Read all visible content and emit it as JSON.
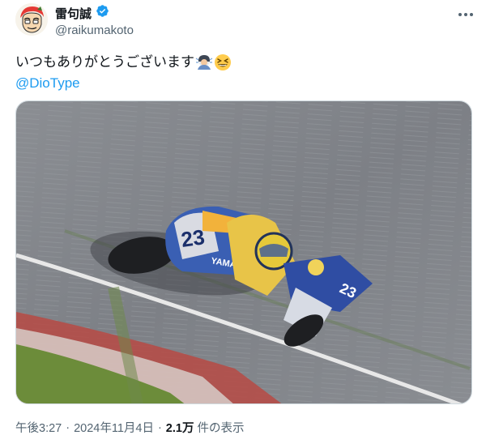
{
  "author": {
    "display_name": "雷句誠",
    "handle": "@raikumakoto",
    "verified_icon": "verified-badge-icon",
    "avatar_icon": "cartoon-avatar"
  },
  "more_icon": "more-dots-icon",
  "tweet": {
    "line1": "いつもありがとうございます",
    "emojis": [
      "racing-rider-emoji",
      "grinning-squinting-face-emoji"
    ],
    "mention": "@DioType"
  },
  "media": {
    "bike_number": "23",
    "brand_text": "YAMAHA"
  },
  "meta": {
    "time": "午後3:27",
    "separator1": "·",
    "date": "2024年11月4日",
    "separator2": "·",
    "views_count": "2.1万",
    "views_label": "件の表示"
  },
  "colors": {
    "accent": "#1d9bf0",
    "text": "#0f1419",
    "secondary": "#536471"
  }
}
